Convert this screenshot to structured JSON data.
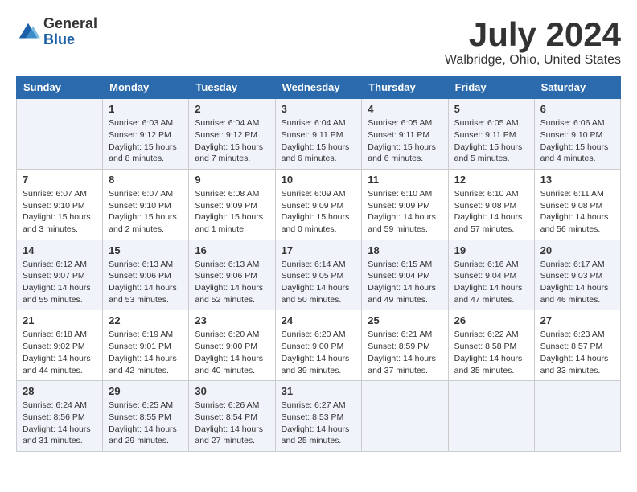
{
  "header": {
    "logo_general": "General",
    "logo_blue": "Blue",
    "title": "July 2024",
    "subtitle": "Walbridge, Ohio, United States"
  },
  "days_of_week": [
    "Sunday",
    "Monday",
    "Tuesday",
    "Wednesday",
    "Thursday",
    "Friday",
    "Saturday"
  ],
  "weeks": [
    [
      {
        "day": "",
        "info": ""
      },
      {
        "day": "1",
        "info": "Sunrise: 6:03 AM\nSunset: 9:12 PM\nDaylight: 15 hours\nand 8 minutes."
      },
      {
        "day": "2",
        "info": "Sunrise: 6:04 AM\nSunset: 9:12 PM\nDaylight: 15 hours\nand 7 minutes."
      },
      {
        "day": "3",
        "info": "Sunrise: 6:04 AM\nSunset: 9:11 PM\nDaylight: 15 hours\nand 6 minutes."
      },
      {
        "day": "4",
        "info": "Sunrise: 6:05 AM\nSunset: 9:11 PM\nDaylight: 15 hours\nand 6 minutes."
      },
      {
        "day": "5",
        "info": "Sunrise: 6:05 AM\nSunset: 9:11 PM\nDaylight: 15 hours\nand 5 minutes."
      },
      {
        "day": "6",
        "info": "Sunrise: 6:06 AM\nSunset: 9:10 PM\nDaylight: 15 hours\nand 4 minutes."
      }
    ],
    [
      {
        "day": "7",
        "info": "Sunrise: 6:07 AM\nSunset: 9:10 PM\nDaylight: 15 hours\nand 3 minutes."
      },
      {
        "day": "8",
        "info": "Sunrise: 6:07 AM\nSunset: 9:10 PM\nDaylight: 15 hours\nand 2 minutes."
      },
      {
        "day": "9",
        "info": "Sunrise: 6:08 AM\nSunset: 9:09 PM\nDaylight: 15 hours\nand 1 minute."
      },
      {
        "day": "10",
        "info": "Sunrise: 6:09 AM\nSunset: 9:09 PM\nDaylight: 15 hours\nand 0 minutes."
      },
      {
        "day": "11",
        "info": "Sunrise: 6:10 AM\nSunset: 9:09 PM\nDaylight: 14 hours\nand 59 minutes."
      },
      {
        "day": "12",
        "info": "Sunrise: 6:10 AM\nSunset: 9:08 PM\nDaylight: 14 hours\nand 57 minutes."
      },
      {
        "day": "13",
        "info": "Sunrise: 6:11 AM\nSunset: 9:08 PM\nDaylight: 14 hours\nand 56 minutes."
      }
    ],
    [
      {
        "day": "14",
        "info": "Sunrise: 6:12 AM\nSunset: 9:07 PM\nDaylight: 14 hours\nand 55 minutes."
      },
      {
        "day": "15",
        "info": "Sunrise: 6:13 AM\nSunset: 9:06 PM\nDaylight: 14 hours\nand 53 minutes."
      },
      {
        "day": "16",
        "info": "Sunrise: 6:13 AM\nSunset: 9:06 PM\nDaylight: 14 hours\nand 52 minutes."
      },
      {
        "day": "17",
        "info": "Sunrise: 6:14 AM\nSunset: 9:05 PM\nDaylight: 14 hours\nand 50 minutes."
      },
      {
        "day": "18",
        "info": "Sunrise: 6:15 AM\nSunset: 9:04 PM\nDaylight: 14 hours\nand 49 minutes."
      },
      {
        "day": "19",
        "info": "Sunrise: 6:16 AM\nSunset: 9:04 PM\nDaylight: 14 hours\nand 47 minutes."
      },
      {
        "day": "20",
        "info": "Sunrise: 6:17 AM\nSunset: 9:03 PM\nDaylight: 14 hours\nand 46 minutes."
      }
    ],
    [
      {
        "day": "21",
        "info": "Sunrise: 6:18 AM\nSunset: 9:02 PM\nDaylight: 14 hours\nand 44 minutes."
      },
      {
        "day": "22",
        "info": "Sunrise: 6:19 AM\nSunset: 9:01 PM\nDaylight: 14 hours\nand 42 minutes."
      },
      {
        "day": "23",
        "info": "Sunrise: 6:20 AM\nSunset: 9:00 PM\nDaylight: 14 hours\nand 40 minutes."
      },
      {
        "day": "24",
        "info": "Sunrise: 6:20 AM\nSunset: 9:00 PM\nDaylight: 14 hours\nand 39 minutes."
      },
      {
        "day": "25",
        "info": "Sunrise: 6:21 AM\nSunset: 8:59 PM\nDaylight: 14 hours\nand 37 minutes."
      },
      {
        "day": "26",
        "info": "Sunrise: 6:22 AM\nSunset: 8:58 PM\nDaylight: 14 hours\nand 35 minutes."
      },
      {
        "day": "27",
        "info": "Sunrise: 6:23 AM\nSunset: 8:57 PM\nDaylight: 14 hours\nand 33 minutes."
      }
    ],
    [
      {
        "day": "28",
        "info": "Sunrise: 6:24 AM\nSunset: 8:56 PM\nDaylight: 14 hours\nand 31 minutes."
      },
      {
        "day": "29",
        "info": "Sunrise: 6:25 AM\nSunset: 8:55 PM\nDaylight: 14 hours\nand 29 minutes."
      },
      {
        "day": "30",
        "info": "Sunrise: 6:26 AM\nSunset: 8:54 PM\nDaylight: 14 hours\nand 27 minutes."
      },
      {
        "day": "31",
        "info": "Sunrise: 6:27 AM\nSunset: 8:53 PM\nDaylight: 14 hours\nand 25 minutes."
      },
      {
        "day": "",
        "info": ""
      },
      {
        "day": "",
        "info": ""
      },
      {
        "day": "",
        "info": ""
      }
    ]
  ]
}
